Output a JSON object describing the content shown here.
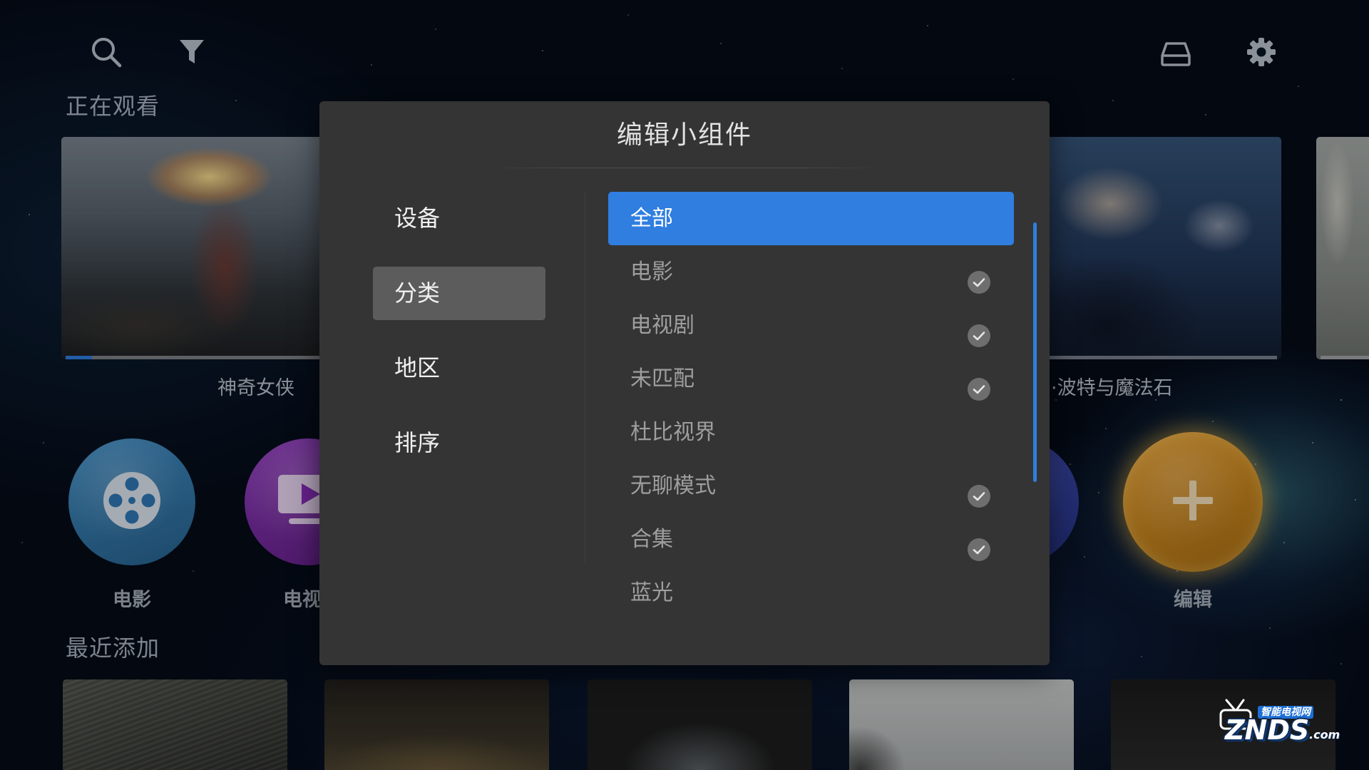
{
  "colors": {
    "accent": "#2f7ee0",
    "background": "#050b17",
    "dialog": "#343434",
    "check": "#6e6e6e"
  },
  "toolbar": {
    "left_icons": [
      "search-icon",
      "filter-icon"
    ],
    "right_icons": [
      "storage-icon",
      "gear-icon"
    ]
  },
  "watching": {
    "heading": "正在观看",
    "items": [
      {
        "title": "神奇女侠",
        "progress": 0.07
      },
      {
        "title": "·波特与魔法石"
      },
      {
        "progress": 0.05
      }
    ]
  },
  "categories": {
    "items": [
      {
        "label": "电影",
        "icon": "film-reel-icon",
        "color": "#3689c6"
      },
      {
        "label": "电视",
        "icon": "tv-play-icon",
        "color": "#8a2dbd"
      },
      {
        "color": "#3444b4"
      },
      {
        "label": "编辑",
        "icon": "plus-icon",
        "color": "#eb9a1c"
      }
    ]
  },
  "recent": {
    "heading": "最近添加"
  },
  "dialog": {
    "title": "编辑小组件",
    "tabs": [
      {
        "label": "设备",
        "selected": false
      },
      {
        "label": "分类",
        "selected": true
      },
      {
        "label": "地区",
        "selected": false
      },
      {
        "label": "排序",
        "selected": false
      }
    ],
    "options": [
      {
        "label": "全部",
        "selected": true,
        "checked": false
      },
      {
        "label": "电影",
        "checked": true
      },
      {
        "label": "电视剧",
        "checked": true
      },
      {
        "label": "未匹配",
        "checked": true
      },
      {
        "label": "杜比视界",
        "checked": false
      },
      {
        "label": "无聊模式",
        "checked": true
      },
      {
        "label": "合集",
        "checked": true
      },
      {
        "label": "蓝光",
        "checked": false
      }
    ]
  },
  "watermark": {
    "tagline": "智能电视网",
    "brand": "ZNDS",
    "suffix": ".com"
  }
}
